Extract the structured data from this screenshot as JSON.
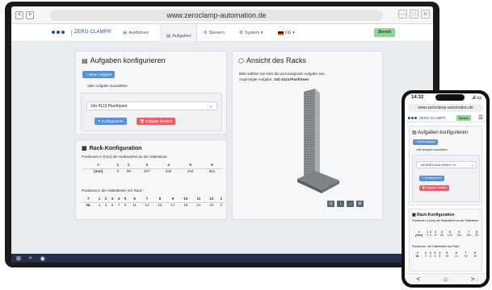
{
  "browser": {
    "back_label": "<",
    "forward_label": ">",
    "url": "www.zeroclamp-automation.de",
    "window_controls": [
      "—",
      "□",
      "✕"
    ]
  },
  "app_nav": {
    "brand": "ZERO CLAMP®",
    "items": [
      {
        "icon": "document-icon",
        "label": "Ausführen"
      },
      {
        "icon": "document-icon",
        "label": "Aufgaben"
      },
      {
        "icon": "move-icon",
        "label": "Steuern"
      },
      {
        "icon": "gear-icon",
        "label": "System ▾"
      },
      {
        "icon": "flag-de-icon",
        "label": "DE ▾"
      }
    ],
    "status": "Bereit",
    "status_color": "#8fd39b"
  },
  "tasks": {
    "title": "Aufgaben konfigurieren",
    "new_task": "+ Neue Aufgabe",
    "or_select": "oder Aufgabe auswählen:",
    "selected_task": "Job 4113 Planfräsen",
    "configure": "Konfigurieren",
    "delete": "Aufgabe löschen"
  },
  "rack_config": {
    "title": "Rack-Konfiguration",
    "positions_label": "Positionen in [mm] der Haltewinkel an der Halteleiste:",
    "pos_header": [
      "#",
      "1",
      "2",
      "3",
      "4",
      "5",
      "6"
    ],
    "pos_values": [
      "[mm]",
      "0",
      "89",
      "207",
      "325",
      "443",
      "561"
    ],
    "bar_label": "Positionsnr. der Halteleisten am Rack:",
    "bar_header": [
      "#",
      "1",
      "2",
      "3",
      "4",
      "5",
      "6",
      "7",
      "8",
      "9",
      "10",
      "11",
      "12",
      "1"
    ],
    "bar_values": [
      "Nr.",
      "1",
      "3",
      "5",
      "7",
      "9",
      "11",
      "13",
      "15",
      "17",
      "19",
      "21",
      "23",
      "2"
    ]
  },
  "rack_view": {
    "title": "Ansicht des Racks",
    "hint": "Bitte wählen Sie links die anzuzeigende Aufgabe aus.",
    "shown_prefix": "Angezeigte Aufgabe:",
    "shown_task": "Job 4113 Planfräsen",
    "controls": [
      "⊡",
      "↕",
      "↔",
      "⊞"
    ]
  },
  "taskbar": {
    "items": [
      "start-icon",
      "search-icon",
      "browser-icon"
    ]
  },
  "phone": {
    "time": "14:32",
    "signal": ".ıl ▭",
    "url": "www.zeroclamp-automation.de",
    "brand": "ZERO CLAMP®",
    "status": "Bereit",
    "menu": "☰",
    "tasks_title": "Aufgaben konfigurieren",
    "new_task": "+ Neue Aufgabe",
    "or_select": "oder Aufgabe auswählen:",
    "selected_task": "Job 4035 Kontur Seite A + B",
    "configure": "Konfigurieren",
    "delete": "Aufgabe löschen",
    "rack_title": "Rack-Konfiguration",
    "positions_label": "Positionen in [mm] der Haltewinkel an der Halteleiste:",
    "pos_header": [
      "#",
      "1",
      "2",
      "3",
      "4",
      "5",
      "6",
      "7",
      "8"
    ],
    "pos_values": [
      "[mm]",
      "0",
      "9",
      "47",
      "85",
      "123",
      "161",
      "199",
      "23"
    ],
    "bar_label": "Positionsnr. der Halteleisten am Rack:",
    "bar_header": [
      "#",
      "1",
      "2",
      "3",
      "4",
      "5",
      "6",
      "7",
      "8"
    ],
    "bar_values": [
      "Nr.",
      "2",
      "4",
      "6",
      "8",
      "10",
      "12",
      "14",
      "16"
    ],
    "nav": [
      "<",
      "⌂",
      ">"
    ]
  }
}
